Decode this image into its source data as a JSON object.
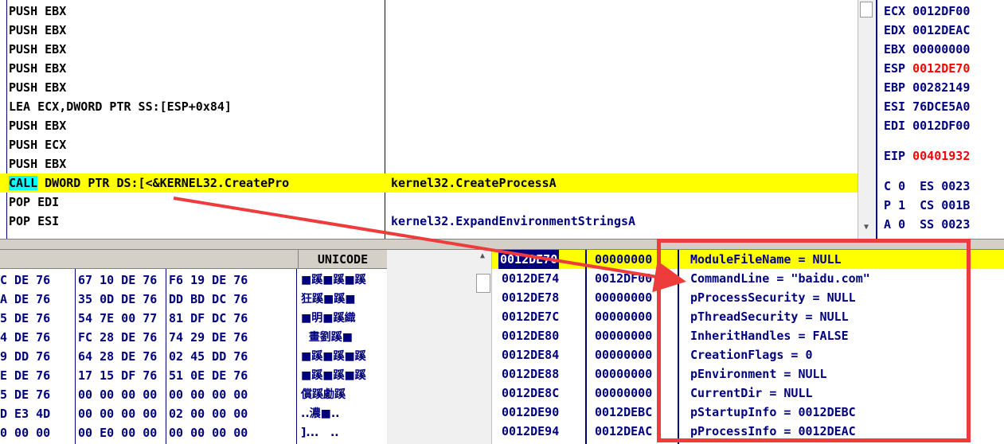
{
  "disassembly": {
    "rows": [
      {
        "ins": "PUSH EBX",
        "comment": ""
      },
      {
        "ins": "PUSH EBX",
        "comment": ""
      },
      {
        "ins": "PUSH EBX",
        "comment": ""
      },
      {
        "ins": "PUSH EBX",
        "comment": ""
      },
      {
        "ins": "PUSH EBX",
        "comment": ""
      },
      {
        "ins": "LEA ECX,DWORD PTR SS:[ESP+0x84]",
        "comment": ""
      },
      {
        "ins": "PUSH EBX",
        "comment": ""
      },
      {
        "ins": "PUSH ECX",
        "comment": ""
      },
      {
        "ins": "PUSH EBX",
        "comment": ""
      },
      {
        "mnemonic": "CALL",
        "ins": " DWORD PTR DS:[<&KERNEL32.CreatePro",
        "comment": "kernel32.CreateProcessA",
        "selected": true
      },
      {
        "ins": "POP EDI",
        "comment": ""
      },
      {
        "ins": "POP ESI",
        "comment": "kernel32.ExpandEnvironmentStringsA"
      }
    ]
  },
  "registers": {
    "rows": [
      {
        "name": "ECX",
        "value": "0012DF00",
        "changed": false
      },
      {
        "name": "EDX",
        "value": "0012DEAC",
        "changed": false
      },
      {
        "name": "EBX",
        "value": "00000000",
        "changed": false
      },
      {
        "name": "ESP",
        "value": "0012DE70",
        "changed": true
      },
      {
        "name": "EBP",
        "value": "00282149",
        "changed": false
      },
      {
        "name": "ESI",
        "value": "76DCE5A0",
        "changed": false
      },
      {
        "name": "EDI",
        "value": "0012DF00",
        "changed": false
      }
    ],
    "eip": {
      "name": "EIP",
      "value": "00401932"
    },
    "flags": [
      {
        "flag": "C",
        "bit": "0",
        "seg": "ES",
        "val": "0023"
      },
      {
        "flag": "P",
        "bit": "1",
        "seg": "CS",
        "val": "001B"
      },
      {
        "flag": "A",
        "bit": "0",
        "seg": "SS",
        "val": "0023"
      }
    ]
  },
  "dump": {
    "unicode_header": "UNICODE",
    "rows": [
      {
        "hex1": "C DE 76",
        "hex2": "67 10 DE 76",
        "hex3": "F6 19 DE 76",
        "uni": "■蹊■蹊■蹊"
      },
      {
        "hex1": "A DE 76",
        "hex2": "35 0D DE 76",
        "hex3": "DD BD DC 76",
        "uni": "狂蹊■蹊■"
      },
      {
        "hex1": "5 DE 76",
        "hex2": "54 7E 00 77",
        "hex3": "81 DF DC 76",
        "uni": "■明■蹊織"
      },
      {
        "hex1": "4 DE 76",
        "hex2": "FC 28 DE 76",
        "hex3": "74 29 DE 76",
        "uni": "  畫劉蹊■"
      },
      {
        "hex1": "9 DD 76",
        "hex2": "64 28 DE 76",
        "hex3": "02 45 DD 76",
        "uni": "■蹊■蹊■蹊"
      },
      {
        "hex1": "E DE 76",
        "hex2": "17 15 DF 76",
        "hex3": "51 0E DE 76",
        "uni": "■蹊■蹊■蹊"
      },
      {
        "hex1": "5 DE 76",
        "hex2": "00 00 00 00",
        "hex3": "00 00 00 00",
        "uni": "償蹊勴蹊"
      },
      {
        "hex1": "D E3 4D",
        "hex2": "00 00 00 00",
        "hex3": "02 00 00 00",
        "uni": "..濃■.."
      },
      {
        "hex1": "0 00 00",
        "hex2": "00 E0 00 00",
        "hex3": "00 00 00 00",
        "uni": "]...   .."
      }
    ]
  },
  "stack": {
    "rows": [
      {
        "addr": "0012DE70",
        "val": "00000000",
        "arg": "ModuleFileName = NULL",
        "selected": true
      },
      {
        "addr": "0012DE74",
        "val": "0012DF00",
        "arg": "CommandLine = \"baidu.com\""
      },
      {
        "addr": "0012DE78",
        "val": "00000000",
        "arg": "pProcessSecurity = NULL"
      },
      {
        "addr": "0012DE7C",
        "val": "00000000",
        "arg": "pThreadSecurity = NULL"
      },
      {
        "addr": "0012DE80",
        "val": "00000000",
        "arg": "InheritHandles = FALSE"
      },
      {
        "addr": "0012DE84",
        "val": "00000000",
        "arg": "CreationFlags = 0"
      },
      {
        "addr": "0012DE88",
        "val": "00000000",
        "arg": "pEnvironment = NULL"
      },
      {
        "addr": "0012DE8C",
        "val": "00000000",
        "arg": "CurrentDir = NULL"
      },
      {
        "addr": "0012DE90",
        "val": "0012DEBC",
        "arg": "pStartupInfo = 0012DEBC"
      },
      {
        "addr": "0012DE94",
        "val": "0012DEAC",
        "arg": "pProcessInfo = 0012DEAC"
      }
    ]
  },
  "colors": {
    "annotation": "#ee3b3b",
    "highlight": "#ffff00",
    "text_dark_blue": "#00007f",
    "changed_register": "#ff0000"
  }
}
